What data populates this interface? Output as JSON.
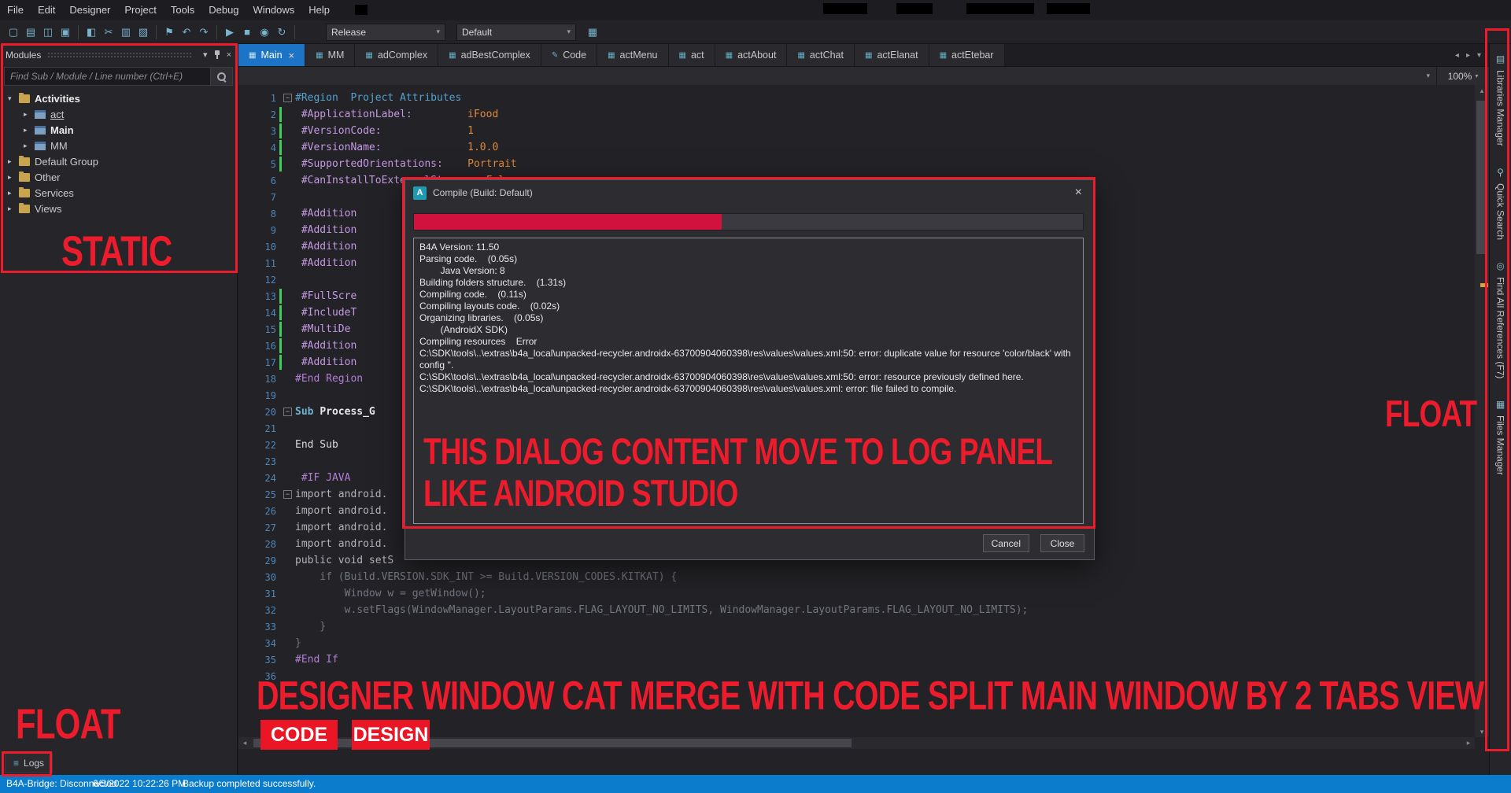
{
  "menubar": {
    "items": [
      "File",
      "Edit",
      "Designer",
      "Project",
      "Tools",
      "Debug",
      "Windows",
      "Help"
    ]
  },
  "toolbar": {
    "icons": [
      {
        "name": "new-project-icon",
        "g": "▢"
      },
      {
        "name": "open-project-icon",
        "g": "▤"
      },
      {
        "name": "save-icon",
        "g": "◫"
      },
      {
        "name": "save-all-icon",
        "g": "▣"
      },
      {
        "name": "separator",
        "g": "",
        "cls": "sep"
      },
      {
        "name": "designer-icon",
        "g": "◧"
      },
      {
        "name": "cut-icon",
        "g": "✂"
      },
      {
        "name": "copy-icon",
        "g": "▥"
      },
      {
        "name": "paste-icon",
        "g": "▨"
      },
      {
        "name": "separator",
        "g": "",
        "cls": "sep"
      },
      {
        "name": "bookmark-icon",
        "g": "⚑"
      },
      {
        "name": "undo-icon",
        "g": "↶"
      },
      {
        "name": "redo-icon",
        "g": "↷"
      },
      {
        "name": "separator",
        "g": "",
        "cls": "sep"
      },
      {
        "name": "run-icon",
        "g": "▶"
      },
      {
        "name": "stop-icon",
        "g": "■"
      },
      {
        "name": "bridge-icon",
        "g": "◉"
      },
      {
        "name": "clean-project-icon",
        "g": "↻"
      },
      {
        "name": "separator",
        "g": "",
        "cls": "sep"
      }
    ],
    "release_combo": "Release",
    "default_combo": "Default",
    "tail_icon": "▦"
  },
  "tabs": {
    "items": [
      {
        "label": "Main",
        "icon": "▦",
        "cls": "active",
        "close": "×"
      },
      {
        "label": "MM",
        "icon": "▦"
      },
      {
        "label": "adComplex",
        "icon": "▦"
      },
      {
        "label": "adBestComplex",
        "icon": "▦"
      },
      {
        "label": "Code",
        "icon": "✎"
      },
      {
        "label": "actMenu",
        "icon": "▦"
      },
      {
        "label": "act",
        "icon": "▦"
      },
      {
        "label": "actAbout",
        "icon": "▦"
      },
      {
        "label": "actChat",
        "icon": "▦"
      },
      {
        "label": "actElanat",
        "icon": "▦"
      },
      {
        "label": "actEtebar",
        "icon": "▦"
      }
    ],
    "scroll_left": "◂",
    "scroll_right": "▸",
    "list_dropdown": "▾"
  },
  "breadcrumb": {
    "combo_arrow": "▾",
    "zoom": "100%",
    "zoom_arrow": "▾"
  },
  "modules_panel": {
    "title": "Modules",
    "collapse_arrow": "▾",
    "close": "×",
    "search_placeholder": "Find Sub / Module / Line number (Ctrl+E)",
    "tree": [
      {
        "label": "Activities",
        "arrow": "▾",
        "icon": "folder",
        "lvl": "l0",
        "cls": "bold"
      },
      {
        "label": "act",
        "arrow": "▸",
        "icon": "module",
        "lvl": "l1",
        "cls": "underline"
      },
      {
        "label": "Main",
        "arrow": "▸",
        "icon": "module",
        "lvl": "l1",
        "cls": "bold"
      },
      {
        "label": "MM",
        "arrow": "▸",
        "icon": "module",
        "lvl": "l1",
        "cls": ""
      },
      {
        "label": "Default Group",
        "arrow": "▸",
        "icon": "folder",
        "lvl": "l0",
        "cls": ""
      },
      {
        "label": "Other",
        "arrow": "▸",
        "icon": "folder",
        "lvl": "l0",
        "cls": ""
      },
      {
        "label": "Services",
        "arrow": "▸",
        "icon": "folder",
        "lvl": "l0",
        "cls": ""
      },
      {
        "label": "Views",
        "arrow": "▸",
        "icon": "folder",
        "lvl": "l0",
        "cls": ""
      }
    ]
  },
  "editor": {
    "lines": [
      {
        "n": "1",
        "fold": "−",
        "foldcls": "show",
        "s1": "#Region  Project Attributes",
        "c1": "dirblue"
      },
      {
        "n": "2",
        "chg": "on",
        "s1": " #ApplicationLabel:",
        "c1": "attr",
        "s2": "         iFood",
        "c2": "val"
      },
      {
        "n": "3",
        "chg": "on",
        "s1": " #VersionCode:",
        "c1": "attr",
        "s2": "              1",
        "c2": "val"
      },
      {
        "n": "4",
        "chg": "on",
        "s1": " #VersionName:",
        "c1": "attr",
        "s2": "              1.0.0",
        "c2": "val"
      },
      {
        "n": "5",
        "chg": "on",
        "s1": " #SupportedOrientations:",
        "c1": "attr",
        "s2": "    Portrait",
        "c2": "val"
      },
      {
        "n": "6",
        "s1": " #CanInstallToExternalStorage:",
        "c1": "attr",
        "s2": " False",
        "c2": "val"
      },
      {
        "n": "7"
      },
      {
        "n": "8",
        "s1": " #Addition",
        "c1": "attr"
      },
      {
        "n": "9",
        "s1": " #Addition",
        "c1": "attr"
      },
      {
        "n": "10",
        "s1": " #Addition",
        "c1": "attr"
      },
      {
        "n": "11",
        "s1": " #Addition",
        "c1": "attr"
      },
      {
        "n": "12"
      },
      {
        "n": "13",
        "chg": "on",
        "s1": " #FullScre",
        "c1": "attr"
      },
      {
        "n": "14",
        "chg": "on",
        "s1": " #IncludeT",
        "c1": "attr"
      },
      {
        "n": "15",
        "chg": "on",
        "s1": " #MultiDe",
        "c1": "attr"
      },
      {
        "n": "16",
        "chg": "on",
        "s1": " #Addition",
        "c1": "attr"
      },
      {
        "n": "17",
        "chg": "on",
        "s1": " #Addition",
        "c1": "attr"
      },
      {
        "n": "18",
        "s1": "#End Region",
        "c1": "dirv"
      },
      {
        "n": "19"
      },
      {
        "n": "20",
        "fold": "−",
        "foldcls": "show",
        "s1": "Sub ",
        "c1": "kw",
        "s2": "Process_G",
        "c2": "id"
      },
      {
        "n": "21"
      },
      {
        "n": "22",
        "s1": "End Sub",
        "c1": "plain"
      },
      {
        "n": "23"
      },
      {
        "n": "24",
        "s1": " #IF JAVA",
        "c1": "dirv"
      },
      {
        "n": "25",
        "fold": "−",
        "foldcls": "show",
        "s1": "import android.",
        "c1": "java"
      },
      {
        "n": "26",
        "s1": "import android.",
        "c1": "java"
      },
      {
        "n": "27",
        "s1": "import android.",
        "c1": "java"
      },
      {
        "n": "28",
        "s1": "import android.",
        "c1": "java"
      },
      {
        "n": "29",
        "s1": "public void setS",
        "c1": "java"
      },
      {
        "n": "30",
        "s1": "    if (Build.VERSION.SDK_INT >= Build.VERSION_CODES.KITKAT) {",
        "c1": "javadim"
      },
      {
        "n": "31",
        "s1": "        Window w = getWindow();",
        "c1": "javadim"
      },
      {
        "n": "32",
        "s1": "        w.setFlags(WindowManager.LayoutParams.FLAG_LAYOUT_NO_LIMITS, WindowManager.LayoutParams.FLAG_LAYOUT_NO_LIMITS);",
        "c1": "javadim"
      },
      {
        "n": "33",
        "s1": "    }",
        "c1": "javadim"
      },
      {
        "n": "34",
        "s1": "}",
        "c1": "javadim"
      },
      {
        "n": "35",
        "s1": "#End If",
        "c1": "dirv"
      },
      {
        "n": "36"
      }
    ]
  },
  "scrollbars": {
    "up": "▴",
    "down": "▾",
    "left": "◂",
    "right": "▸"
  },
  "right_strip": {
    "items": [
      {
        "label": "Libraries Manager",
        "icon": "▤",
        "name": "libraries-manager-tab"
      },
      {
        "label": "Quick Search",
        "icon": "⚲",
        "name": "quick-search-tab"
      },
      {
        "label": "Find All References (F7)",
        "icon": "◎",
        "name": "find-all-references-tab"
      },
      {
        "label": "Files Manager",
        "icon": "▦",
        "name": "files-manager-tab"
      }
    ]
  },
  "logs_button": {
    "icon": "≡",
    "label": "Logs"
  },
  "statusbar": {
    "bridge": "B4A-Bridge: Disconnected",
    "datetime": "6/5/2022 10:22:26 PM",
    "backup": "Backup completed successfully."
  },
  "dialog": {
    "title": "Compile (Build: Default)",
    "icon_letter": "A",
    "close": "×",
    "progress_percent": 46,
    "log_lines": [
      "B4A Version: 11.50",
      "Parsing code.    (0.05s)",
      "        Java Version: 8",
      "Building folders structure.    (1.31s)",
      "Compiling code.    (0.11s)",
      "Compiling layouts code.    (0.02s)",
      "Organizing libraries.    (0.05s)",
      "        (AndroidX SDK)",
      "Compiling resources    Error",
      "C:\\SDK\\tools\\..\\extras\\b4a_local\\unpacked-recycler.androidx-63700904060398\\res\\values\\values.xml:50: error: duplicate value for resource 'color/black' with config ''.",
      "C:\\SDK\\tools\\..\\extras\\b4a_local\\unpacked-recycler.androidx-63700904060398\\res\\values\\values.xml:50: error: resource previously defined here.",
      "C:\\SDK\\tools\\..\\extras\\b4a_local\\unpacked-recycler.androidx-63700904060398\\res\\values\\values.xml: error: file failed to compile."
    ],
    "cancel_label": "Cancel",
    "close_label": "Close"
  },
  "annotations": {
    "static_label": "STATIC",
    "float_left": "FLOAT",
    "float_right": "FLOAT",
    "dialog_note_1": "THIS DIALOG CONTENT MOVE TO LOG PANEL",
    "dialog_note_2": "LIKE ANDROID STUDIO",
    "bottom_note": "DESIGNER WINDOW CAT MERGE WITH CODE SPLIT MAIN WINDOW BY 2 TABS VIEW",
    "code_tab": "CODE",
    "design_tab": "DESIGN"
  }
}
